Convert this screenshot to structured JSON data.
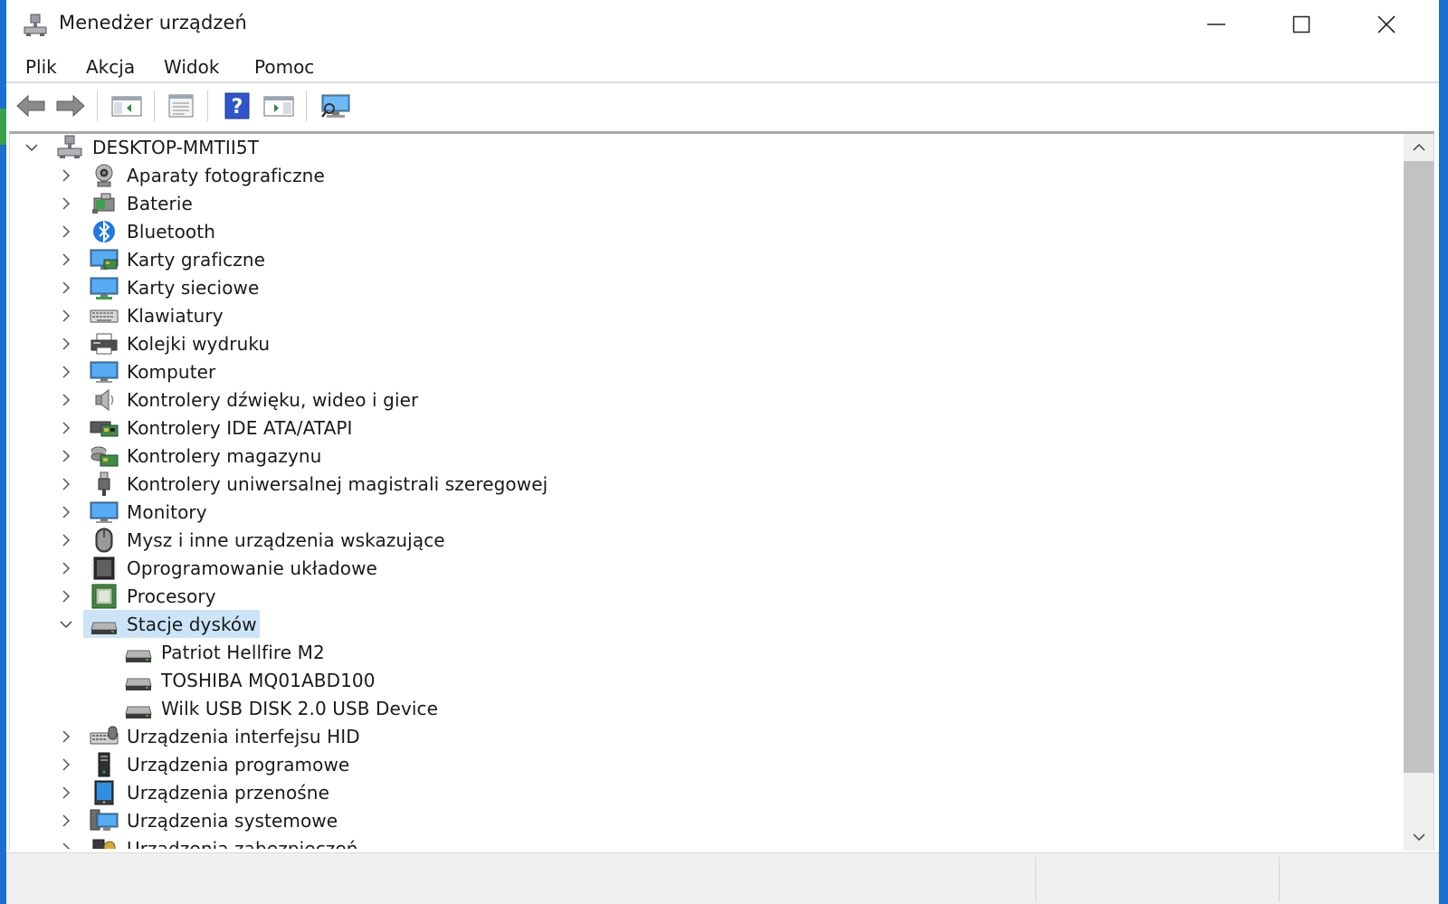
{
  "window": {
    "title": "Menedżer urządzeń"
  },
  "menu": {
    "items": [
      "Plik",
      "Akcja",
      "Widok",
      "Pomoc"
    ]
  },
  "toolbar": {
    "buttons": [
      "back-arrow-icon",
      "forward-arrow-icon",
      "show-hide-console-tree-icon",
      "properties-icon",
      "help-icon",
      "action-pane-icon",
      "scan-hardware-icon"
    ]
  },
  "tree": {
    "root": {
      "label": "DESKTOP-MMTII5T",
      "icon": "computer-network-icon",
      "expanded": true
    },
    "categories": [
      {
        "label": "Aparaty fotograficzne",
        "icon": "camera-icon",
        "expanded": false
      },
      {
        "label": "Baterie",
        "icon": "battery-icon",
        "expanded": false
      },
      {
        "label": "Bluetooth",
        "icon": "bluetooth-icon",
        "expanded": false
      },
      {
        "label": "Karty graficzne",
        "icon": "display-adapter-icon",
        "expanded": false
      },
      {
        "label": "Karty sieciowe",
        "icon": "network-adapter-icon",
        "expanded": false
      },
      {
        "label": "Klawiatury",
        "icon": "keyboard-icon",
        "expanded": false
      },
      {
        "label": "Kolejki wydruku",
        "icon": "printer-icon",
        "expanded": false
      },
      {
        "label": "Komputer",
        "icon": "monitor-icon",
        "expanded": false
      },
      {
        "label": "Kontrolery dźwięku, wideo i gier",
        "icon": "speaker-icon",
        "expanded": false
      },
      {
        "label": "Kontrolery IDE ATA/ATAPI",
        "icon": "ide-controller-icon",
        "expanded": false
      },
      {
        "label": "Kontrolery magazynu",
        "icon": "storage-controller-icon",
        "expanded": false
      },
      {
        "label": "Kontrolery uniwersalnej magistrali szeregowej",
        "icon": "usb-plug-icon",
        "expanded": false
      },
      {
        "label": "Monitory",
        "icon": "monitor-icon",
        "expanded": false
      },
      {
        "label": "Mysz i inne urządzenia wskazujące",
        "icon": "mouse-icon",
        "expanded": false
      },
      {
        "label": "Oprogramowanie układowe",
        "icon": "firmware-chip-icon",
        "expanded": false
      },
      {
        "label": "Procesory",
        "icon": "processor-icon",
        "expanded": false
      },
      {
        "label": "Stacje dysków",
        "icon": "disk-drive-icon",
        "expanded": true,
        "selected": true,
        "children": [
          {
            "label": "Patriot Hellfire M2",
            "icon": "disk-drive-icon"
          },
          {
            "label": "TOSHIBA MQ01ABD100",
            "icon": "disk-drive-icon"
          },
          {
            "label": "Wilk USB DISK 2.0 USB Device",
            "icon": "disk-drive-icon"
          }
        ]
      },
      {
        "label": "Urządzenia interfejsu HID",
        "icon": "hid-device-icon",
        "expanded": false
      },
      {
        "label": "Urządzenia programowe",
        "icon": "software-device-icon",
        "expanded": false
      },
      {
        "label": "Urządzenia przenośne",
        "icon": "portable-device-icon",
        "expanded": false
      },
      {
        "label": "Urządzenia systemowe",
        "icon": "system-device-icon",
        "expanded": false
      },
      {
        "label": "Urządzenia zabezpieczeń",
        "icon": "security-device-icon",
        "expanded": false
      }
    ]
  },
  "colors": {
    "selection": "#cce4f7",
    "accent_blue": "#1b6fd1",
    "monitor_blue": "#2f8fe6"
  }
}
